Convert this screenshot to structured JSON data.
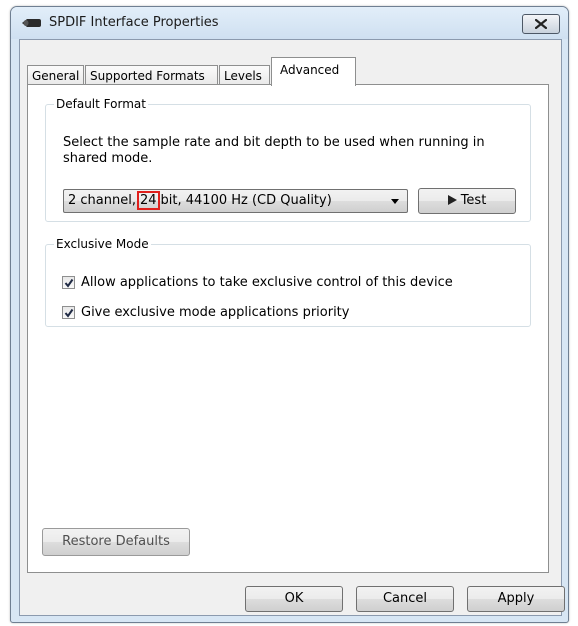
{
  "window": {
    "title": "SPDIF Interface Properties",
    "app_icon": "speaker-device-icon",
    "close_icon": "close-icon"
  },
  "tabs": [
    {
      "label": "General",
      "active": false
    },
    {
      "label": "Supported Formats",
      "active": false
    },
    {
      "label": "Levels",
      "active": false
    },
    {
      "label": "Advanced",
      "active": true
    }
  ],
  "default_format": {
    "legend": "Default Format",
    "description": "Select the sample rate and bit depth to be used when running in shared mode.",
    "format_select": {
      "prefix": "2 channel,",
      "highlight": "24",
      "suffix": "bit, 44100 Hz (CD Quality)"
    },
    "test_button": "Test",
    "highlight_color": "#e0201c"
  },
  "exclusive_mode": {
    "legend": "Exclusive Mode",
    "options": [
      {
        "label": "Allow applications to take exclusive control of this device",
        "checked": true
      },
      {
        "label": "Give exclusive mode applications priority",
        "checked": true
      }
    ]
  },
  "restore_defaults": "Restore Defaults",
  "footer": {
    "ok": "OK",
    "cancel": "Cancel",
    "apply": "Apply"
  }
}
